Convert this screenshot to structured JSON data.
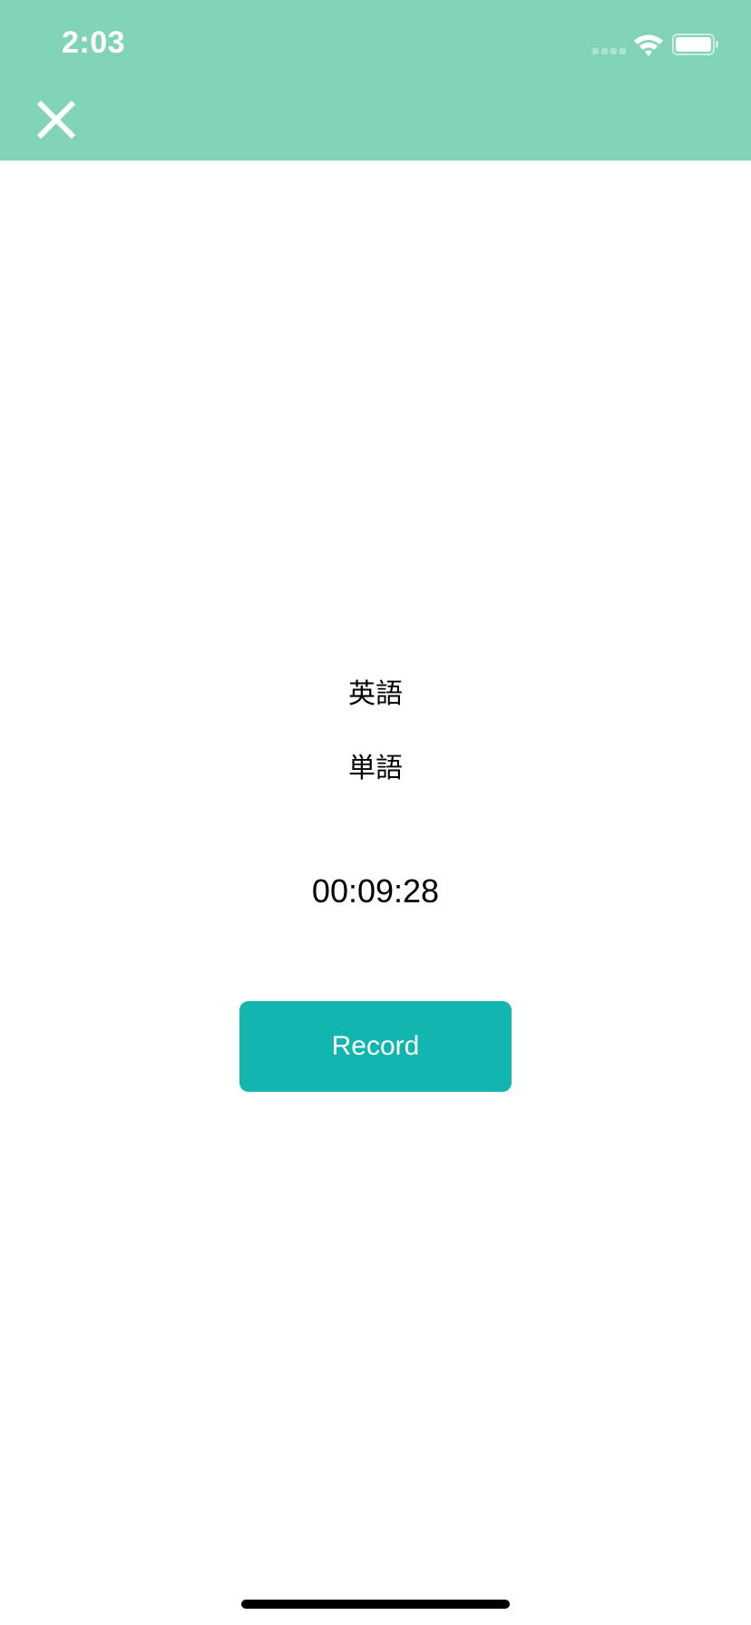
{
  "status_bar": {
    "time": "2:03",
    "signal_icon": "cellular-signal-icon",
    "wifi_icon": "wifi-icon",
    "battery_icon": "battery-icon"
  },
  "header": {
    "background_color": "#81d4b6",
    "close_icon": "close-icon"
  },
  "main": {
    "label_1": "英語",
    "label_2": "単語",
    "timer": "00:09:28",
    "record_button_label": "Record",
    "record_button_color": "#12b5b0"
  }
}
